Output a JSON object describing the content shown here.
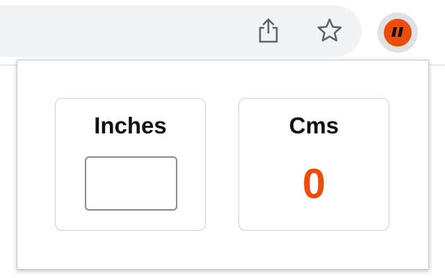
{
  "browser": {
    "toolbar_icons": [
      "share-icon",
      "star-icon"
    ],
    "extension": {
      "icon": "quote-logo-icon",
      "glyph": "”",
      "color": "#ee4c0b"
    }
  },
  "popup": {
    "inches": {
      "title": "Inches",
      "input_value": ""
    },
    "cms": {
      "title": "Cms",
      "value": "0"
    },
    "accent_color": "#ee4c0b"
  }
}
